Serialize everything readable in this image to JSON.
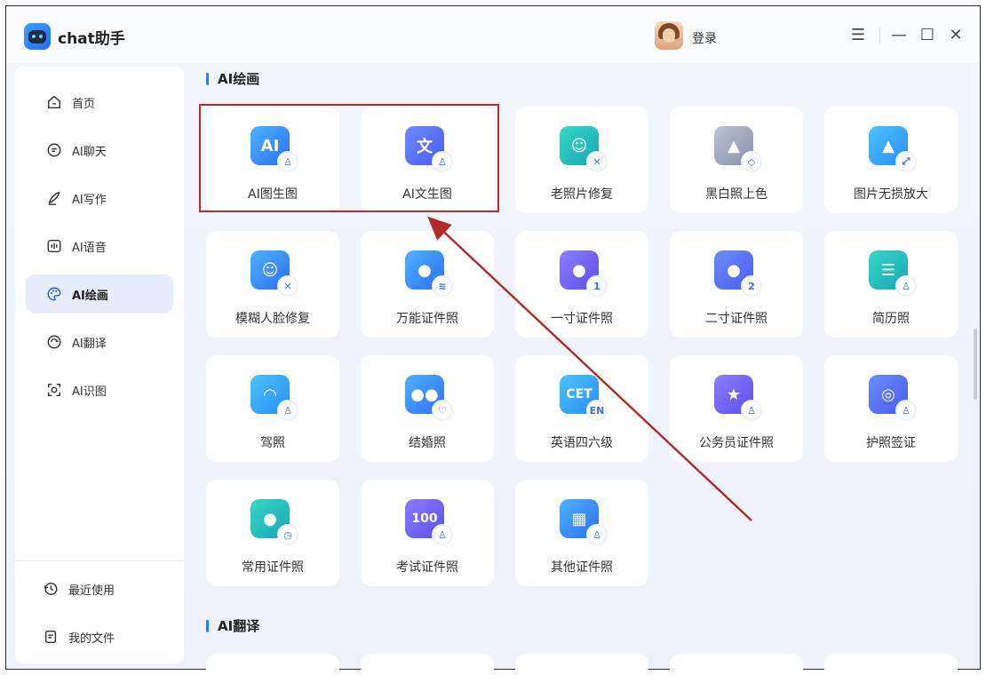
{
  "app": {
    "title": "chat助手",
    "login_label": "登录"
  },
  "window_controls": {
    "menu": "☰",
    "minimize": "—",
    "maximize": "☐",
    "close": "✕"
  },
  "sidebar": {
    "items": [
      {
        "label": "首页",
        "icon": "home-icon"
      },
      {
        "label": "AI聊天",
        "icon": "chat-icon"
      },
      {
        "label": "AI写作",
        "icon": "pen-icon"
      },
      {
        "label": "AI语音",
        "icon": "voice-icon"
      },
      {
        "label": "AI绘画",
        "icon": "palette-icon",
        "active": true
      },
      {
        "label": "AI翻译",
        "icon": "translate-icon"
      },
      {
        "label": "AI识图",
        "icon": "scan-icon"
      }
    ],
    "bottom": [
      {
        "label": "最近使用",
        "icon": "history-icon"
      },
      {
        "label": "我的文件",
        "icon": "file-icon"
      }
    ]
  },
  "sections": {
    "drawing": "AI绘画",
    "translate": "AI翻译"
  },
  "cards": [
    {
      "label": "AI图生图",
      "glyph": "AI",
      "badge": "♙"
    },
    {
      "label": "AI文生图",
      "glyph": "文",
      "badge": "♙"
    },
    {
      "label": "老照片修复",
      "glyph": "☺",
      "badge": "✕"
    },
    {
      "label": "黑白照上色",
      "glyph": "▲",
      "badge": "◇"
    },
    {
      "label": "图片无损放大",
      "glyph": "▲",
      "badge": "⤢"
    },
    {
      "label": "模糊人脸修复",
      "glyph": "☺",
      "badge": "✕"
    },
    {
      "label": "万能证件照",
      "glyph": "●",
      "badge": "≋"
    },
    {
      "label": "一寸证件照",
      "glyph": "●",
      "badge": "1"
    },
    {
      "label": "二寸证件照",
      "glyph": "●",
      "badge": "2"
    },
    {
      "label": "简历照",
      "glyph": "☰",
      "badge": "♙"
    },
    {
      "label": "驾照",
      "glyph": "◠",
      "badge": "♙"
    },
    {
      "label": "结婚照",
      "glyph": "●●",
      "badge": "♡"
    },
    {
      "label": "英语四六级",
      "glyph": "CET",
      "badge": "EN"
    },
    {
      "label": "公务员证件照",
      "glyph": "★",
      "badge": "♙"
    },
    {
      "label": "护照签证",
      "glyph": "◎",
      "badge": "♙"
    },
    {
      "label": "常用证件照",
      "glyph": "●",
      "badge": "◷"
    },
    {
      "label": "考试证件照",
      "glyph": "100",
      "badge": "♙"
    },
    {
      "label": "其他证件照",
      "glyph": "▦",
      "badge": "♙"
    }
  ],
  "colors": {
    "accent": "#2b7cf6",
    "highlight": "#c0262a",
    "active_bg": "#e7eefb"
  }
}
